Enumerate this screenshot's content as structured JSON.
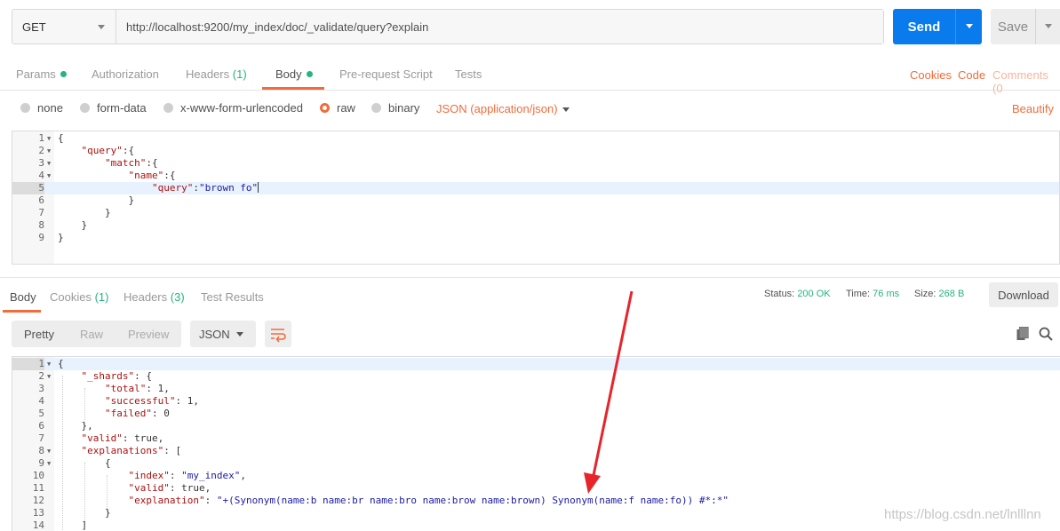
{
  "request": {
    "method": "GET",
    "url": "http://localhost:9200/my_index/doc/_validate/query?explain",
    "send_label": "Send",
    "save_label": "Save"
  },
  "request_tabs": {
    "params": "Params",
    "authorization": "Authorization",
    "headers": "Headers",
    "headers_count": "(1)",
    "body": "Body",
    "prerequest": "Pre-request Script",
    "tests": "Tests",
    "cookies": "Cookies",
    "code": "Code",
    "comments": "Comments (0"
  },
  "body_types": {
    "none": "none",
    "form_data": "form-data",
    "urlencoded": "x-www-form-urlencoded",
    "raw": "raw",
    "binary": "binary",
    "selected": "raw",
    "content_type": "JSON (application/json)",
    "beautify": "Beautify"
  },
  "request_body": {
    "lines": [
      {
        "n": "1",
        "fold": true,
        "html": "{"
      },
      {
        "n": "2",
        "fold": true,
        "html": "    <span class='k'>\"query\"</span>:{"
      },
      {
        "n": "3",
        "fold": true,
        "html": "        <span class='k'>\"match\"</span>:{"
      },
      {
        "n": "4",
        "fold": true,
        "html": "            <span class='k'>\"name\"</span>:{"
      },
      {
        "n": "5",
        "fold": false,
        "active": true,
        "html": "                <span class='k'>\"query\"</span>:<span class='s'>\"brown fo\"</span>"
      },
      {
        "n": "6",
        "fold": false,
        "html": "            }"
      },
      {
        "n": "7",
        "fold": false,
        "html": "        }"
      },
      {
        "n": "8",
        "fold": false,
        "html": "    }"
      },
      {
        "n": "9",
        "fold": false,
        "html": "}"
      }
    ]
  },
  "response_tabs": {
    "body": "Body",
    "cookies": "Cookies",
    "cookies_count": "(1)",
    "headers": "Headers",
    "headers_count": "(3)",
    "test_results": "Test Results"
  },
  "response_status": {
    "status_label": "Status:",
    "status_value": "200 OK",
    "time_label": "Time:",
    "time_value": "76 ms",
    "size_label": "Size:",
    "size_value": "268 B",
    "download": "Download"
  },
  "response_toolbar": {
    "pretty": "Pretty",
    "raw": "Raw",
    "preview": "Preview",
    "format": "JSON"
  },
  "response_body": {
    "lines": [
      {
        "n": "1",
        "fold": true,
        "active": true,
        "html": "{"
      },
      {
        "n": "2",
        "fold": true,
        "html": "    <span class='k'>\"_shards\"</span>: {"
      },
      {
        "n": "3",
        "fold": false,
        "html": "        <span class='k'>\"total\"</span>: 1,"
      },
      {
        "n": "4",
        "fold": false,
        "html": "        <span class='k'>\"successful\"</span>: 1,"
      },
      {
        "n": "5",
        "fold": false,
        "html": "        <span class='k'>\"failed\"</span>: 0"
      },
      {
        "n": "6",
        "fold": false,
        "html": "    },"
      },
      {
        "n": "7",
        "fold": false,
        "html": "    <span class='k'>\"valid\"</span>: true,"
      },
      {
        "n": "8",
        "fold": true,
        "html": "    <span class='k'>\"explanations\"</span>: ["
      },
      {
        "n": "9",
        "fold": true,
        "html": "        {"
      },
      {
        "n": "10",
        "fold": false,
        "html": "            <span class='k'>\"index\"</span>: <span class='s'>\"my_index\"</span>,"
      },
      {
        "n": "11",
        "fold": false,
        "html": "            <span class='k'>\"valid\"</span>: true,"
      },
      {
        "n": "12",
        "fold": false,
        "html": "            <span class='k'>\"explanation\"</span>: <span class='s'>\"+(Synonym(name:b name:br name:bro name:brow name:brown) Synonym(name:f name:fo)) #*:*\"</span>"
      },
      {
        "n": "13",
        "fold": false,
        "html": "        }"
      },
      {
        "n": "14",
        "fold": false,
        "html": "    ]"
      }
    ]
  },
  "watermark": "https://blog.csdn.net/lnlllnn",
  "colors": {
    "accent": "#f26b3a",
    "send_blue": "#097bed",
    "ok_green": "#26b47f",
    "arrow_red": "#e8242b"
  }
}
